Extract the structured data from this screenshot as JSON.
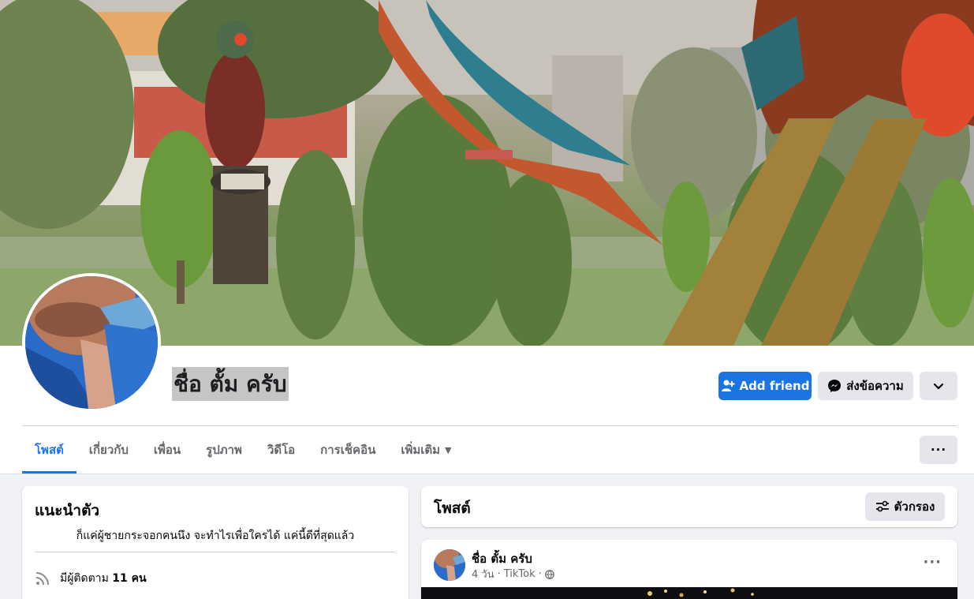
{
  "profile": {
    "name": "ชื่อ ตั้ม ครับ"
  },
  "actions": {
    "add_friend": "Add friend",
    "message": "ส่งข้อความ"
  },
  "tabs": [
    {
      "label": "โพสต์",
      "active": true
    },
    {
      "label": "เกี่ยวกับ"
    },
    {
      "label": "เพื่อน"
    },
    {
      "label": "รูปภาพ"
    },
    {
      "label": "วิดีโอ"
    },
    {
      "label": "การเช็คอิน"
    },
    {
      "label": "เพิ่มเติม"
    }
  ],
  "tab_more_caret": "▼",
  "more_menu": "···",
  "intro": {
    "title": "แนะนำตัว",
    "bio": "ก็แค่ผู้ชายกระจอกคนนึง จะทำไรเพื่อใครได้ แค่นี้ดีที่สุดแล้ว",
    "followers_prefix": "มีผู้ติดตาม",
    "followers_count": "11 คน"
  },
  "posts": {
    "title": "โพสต์",
    "filter_label": "ตัวกรอง"
  },
  "post": {
    "author": "ชื่อ ตั้ม ครับ",
    "time": "4 วัน",
    "source": "TikTok",
    "separator": "·",
    "more": "···"
  },
  "colors": {
    "accent": "#1b74e4",
    "secondary_button": "#e4e6eb",
    "page_bg": "#f0f2f5"
  },
  "icons": {
    "add_friend": "person-plus-icon",
    "message": "messenger-icon",
    "dropdown": "chevron-down-icon",
    "followers": "rss-icon",
    "filter": "sliders-icon",
    "privacy": "globe-icon"
  }
}
